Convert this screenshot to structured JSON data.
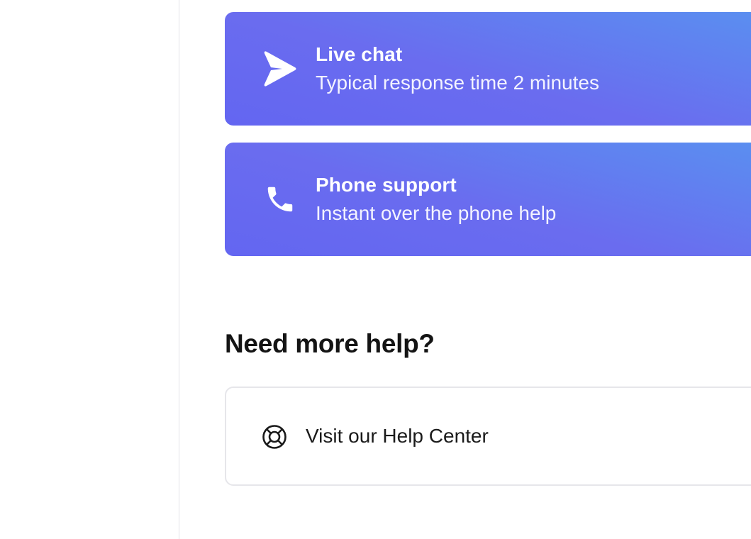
{
  "support_options": [
    {
      "icon": "send-icon",
      "title": "Live chat",
      "subtitle": "Typical response time 2 minutes"
    },
    {
      "icon": "phone-icon",
      "title": "Phone support",
      "subtitle": "Instant over the phone help"
    }
  ],
  "more_help": {
    "heading": "Need more help?",
    "help_center": {
      "icon": "lifebuoy-icon",
      "label": "Visit our Help Center"
    }
  },
  "colors": {
    "card_gradient_start": "#6366f1",
    "card_gradient_end": "#5a8ff0",
    "heading_text": "#141414",
    "border": "#e6e6ea"
  }
}
